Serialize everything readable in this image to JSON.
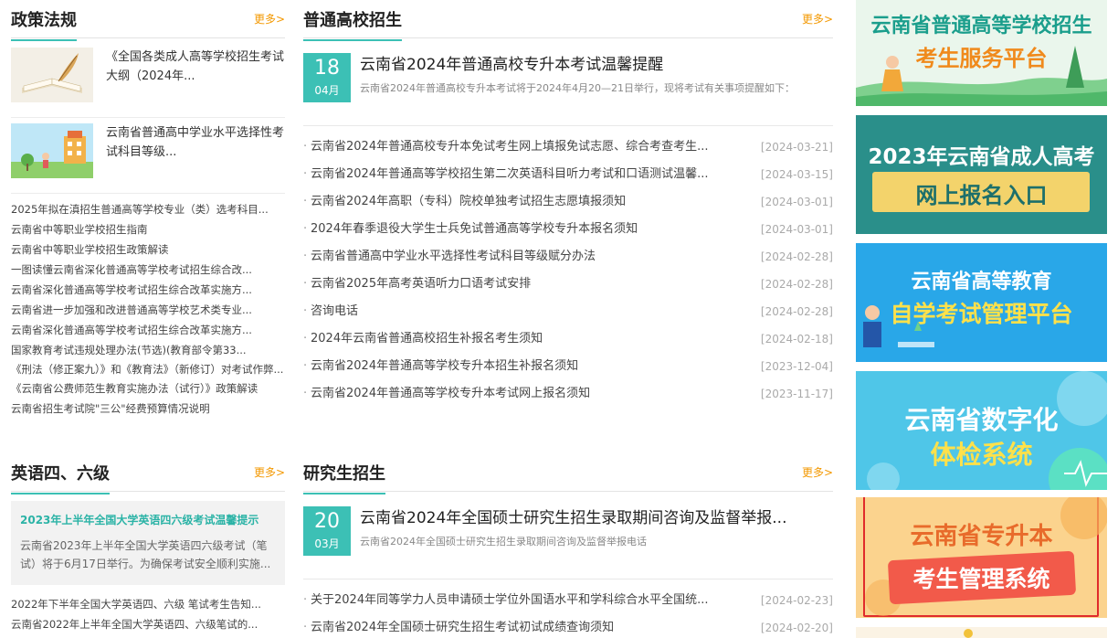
{
  "policy": {
    "title": "政策法规",
    "more": "更多>",
    "pic_items": [
      {
        "text": "《全国各类成人高等学校招生考试大纲（2024年..."
      },
      {
        "text": "云南省普通高中学业水平选择性考试科目等级..."
      }
    ],
    "items": [
      "2025年拟在滇招生普通高等学校专业（类）选考科目...",
      "云南省中等职业学校招生指南",
      "云南省中等职业学校招生政策解读",
      "一图读懂云南省深化普通高等学校考试招生综合改...",
      "云南省深化普通高等学校考试招生综合改革实施方...",
      "云南省进一步加强和改进普通高等学校艺术类专业...",
      "云南省深化普通高等学校考试招生综合改革实施方...",
      "国家教育考试违规处理办法(节选)(教育部令第33...",
      "《刑法（修正案九）》和《教育法》（新修订）对考试作弊...",
      "《云南省公费师范生教育实施办法（试行）》政策解读",
      "云南省招生考试院\"三公\"经费预算情况说明"
    ]
  },
  "general": {
    "title": "普通高校招生",
    "more": "更多>",
    "featured": {
      "day": "18",
      "month": "04月",
      "title": "云南省2024年普通高校专升本考试温馨提醒",
      "summary": "云南省2024年普通高校专升本考试将于2024年4月20—21日举行，现将考试有关事项提醒如下："
    },
    "news": [
      {
        "text": "云南省2024年普通高校专升本免试考生网上填报免试志愿、综合考查考生...",
        "date": "[2024-03-21]"
      },
      {
        "text": "云南省2024年普通高等学校招生第二次英语科目听力考试和口语测试温馨...",
        "date": "[2024-03-15]"
      },
      {
        "text": "云南省2024年高职（专科）院校单独考试招生志愿填报须知",
        "date": "[2024-03-01]"
      },
      {
        "text": "2024年春季退役大学生士兵免试普通高等学校专升本报名须知",
        "date": "[2024-03-01]"
      },
      {
        "text": "云南省普通高中学业水平选择性考试科目等级赋分办法",
        "date": "[2024-02-28]"
      },
      {
        "text": "云南省2025年高考英语听力口语考试安排",
        "date": "[2024-02-28]"
      },
      {
        "text": "咨询电话",
        "date": "[2024-02-28]"
      },
      {
        "text": "2024年云南省普通高校招生补报名考生须知",
        "date": "[2024-02-18]"
      },
      {
        "text": "云南省2024年普通高等学校专升本招生补报名须知",
        "date": "[2023-12-04]"
      },
      {
        "text": "云南省2024年普通高等学校专升本考试网上报名须知",
        "date": "[2023-11-17]"
      }
    ]
  },
  "cet": {
    "title": "英语四、六级",
    "more": "更多>",
    "box_title": "2023年上半年全国大学英语四六级考试温馨提示",
    "box_summary": "云南省2023年上半年全国大学英语四六级考试（笔试）将于6月17日举行。为确保考试安全顺利实施...",
    "items": [
      "2022年下半年全国大学英语四、六级 笔试考生告知...",
      "云南省2022年上半年全国大学英语四、六级笔试的..."
    ]
  },
  "grad": {
    "title": "研究生招生",
    "more": "更多>",
    "featured": {
      "day": "20",
      "month": "03月",
      "title": "云南省2024年全国硕士研究生招生录取期间咨询及监督举报...",
      "summary": "云南省2024年全国硕士研究生招生录取期间咨询及监督举报电话"
    },
    "news": [
      {
        "text": "关于2024年同等学力人员申请硕士学位外国语水平和学科综合水平全国统...",
        "date": "[2024-02-23]"
      },
      {
        "text": "云南省2024年全国硕士研究生招生考试初试成绩查询须知",
        "date": "[2024-02-20]"
      }
    ]
  },
  "banners": [
    {
      "line1": "云南省普通高等学校招生",
      "line2": "考生服务平台"
    },
    {
      "line1": "2023年云南省成人高考",
      "line2": "网上报名入口"
    },
    {
      "line1": "云南省高等教育",
      "line2": "自学考试管理平台"
    },
    {
      "line1": "云南省数字化",
      "line2": "体检系统"
    },
    {
      "line1": "云南省专升本",
      "line2": "考生管理系统"
    }
  ],
  "colors": {
    "accent": "#3cc0b5",
    "more": "#f39800",
    "highlight_border": "#e02b2b"
  }
}
